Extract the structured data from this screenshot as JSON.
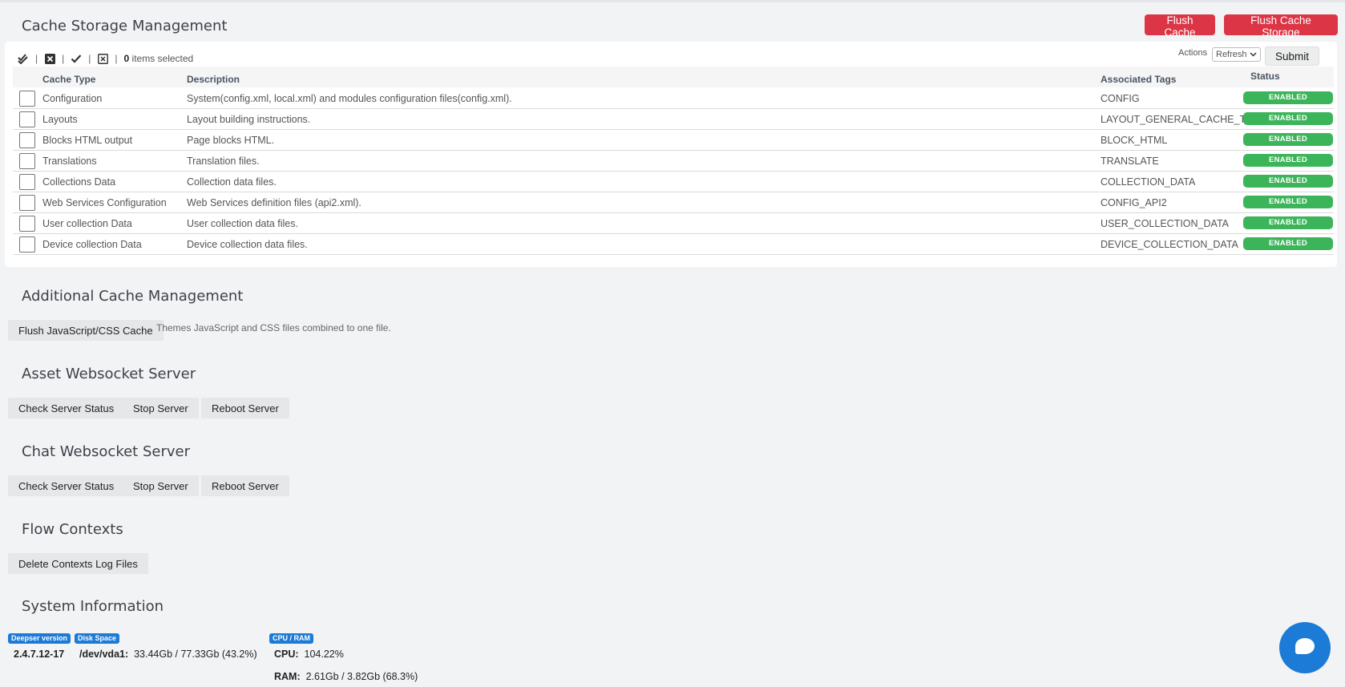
{
  "cache_storage": {
    "title": "Cache Storage Management",
    "flush_cache_label": "Flush Cache",
    "flush_storage_label": "Flush Cache Storage",
    "toolbar": {
      "separator": "|",
      "selected_count": "0",
      "selected_text": "items selected"
    },
    "actions_label": "Actions",
    "actions_value": "Refresh",
    "submit_label": "Submit",
    "columns": {
      "type": "Cache Type",
      "description": "Description",
      "tags": "Associated Tags",
      "status": "Status"
    },
    "rows": [
      {
        "type": "Configuration",
        "description": "System(config.xml, local.xml) and modules configuration files(config.xml).",
        "tags": "CONFIG",
        "status": "ENABLED"
      },
      {
        "type": "Layouts",
        "description": "Layout building instructions.",
        "tags": "LAYOUT_GENERAL_CACHE_TAG",
        "status": "ENABLED"
      },
      {
        "type": "Blocks HTML output",
        "description": "Page blocks HTML.",
        "tags": "BLOCK_HTML",
        "status": "ENABLED"
      },
      {
        "type": "Translations",
        "description": "Translation files.",
        "tags": "TRANSLATE",
        "status": "ENABLED"
      },
      {
        "type": "Collections Data",
        "description": "Collection data files.",
        "tags": "COLLECTION_DATA",
        "status": "ENABLED"
      },
      {
        "type": "Web Services Configuration",
        "description": "Web Services definition files (api2.xml).",
        "tags": "CONFIG_API2",
        "status": "ENABLED"
      },
      {
        "type": "User collection Data",
        "description": "User collection data files.",
        "tags": "USER_COLLECTION_DATA",
        "status": "ENABLED"
      },
      {
        "type": "Device collection Data",
        "description": "Device collection data files.",
        "tags": "DEVICE_COLLECTION_DATA",
        "status": "ENABLED"
      }
    ]
  },
  "additional": {
    "title": "Additional Cache Management",
    "flush_js_label": "Flush JavaScript/CSS Cache",
    "flush_js_desc": "Themes JavaScript and CSS files combined to one file."
  },
  "asset_ws": {
    "title": "Asset Websocket Server",
    "check_label": "Check Server Status",
    "stop_label": "Stop Server",
    "reboot_label": "Reboot Server"
  },
  "chat_ws": {
    "title": "Chat Websocket Server",
    "check_label": "Check Server Status",
    "stop_label": "Stop Server",
    "reboot_label": "Reboot Server"
  },
  "flow": {
    "title": "Flow Contexts",
    "delete_label": "Delete Contexts Log Files"
  },
  "sysinfo": {
    "title": "System Information",
    "version_tag": "Deepser version",
    "version_value": "2.4.7.12-17",
    "disk_tag": "Disk Space",
    "disk_device": "/dev/vda1:",
    "disk_value": "33.44Gb / 77.33Gb (43.2%)",
    "cpu_tag": "CPU / RAM",
    "cpu_label": "CPU:",
    "cpu_value": "104.22%",
    "ram_label": "RAM:",
    "ram_value": "2.61Gb / 3.82Gb (68.3%)"
  },
  "colors": {
    "danger": "#dc3545",
    "enabled": "#3cb55a",
    "info": "#1c7bd6"
  },
  "icons": [
    "check-double-icon",
    "square-x-icon",
    "check-icon",
    "square-x-outline-icon",
    "chevron-down-icon",
    "chat-bubble-icon"
  ]
}
